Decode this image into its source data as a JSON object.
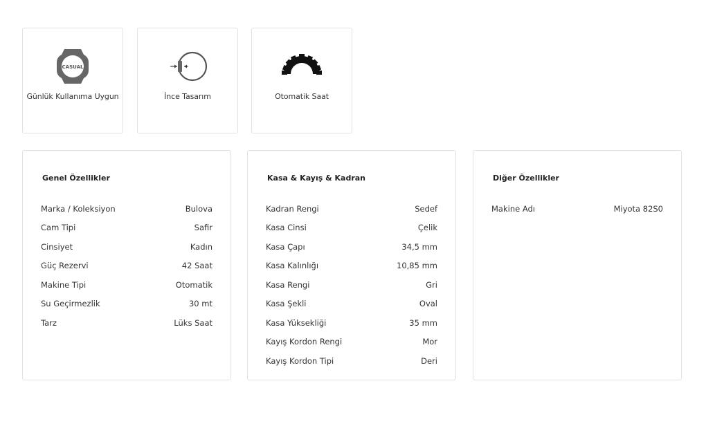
{
  "features": [
    {
      "icon": "casual-watch-icon",
      "badge_text": "CASUAL",
      "label": "Günlük Kullanıma Uygun"
    },
    {
      "icon": "thin-design-icon",
      "label": "İnce Tasarım"
    },
    {
      "icon": "automatic-gear-icon",
      "label": "Otomatik Saat"
    }
  ],
  "sections": [
    {
      "title": "Genel Özellikler",
      "rows": [
        {
          "key": "Marka / Koleksiyon",
          "value": "Bulova"
        },
        {
          "key": "Cam Tipi",
          "value": "Safir"
        },
        {
          "key": "Cinsiyet",
          "value": "Kadın"
        },
        {
          "key": "Güç Rezervi",
          "value": "42 Saat"
        },
        {
          "key": "Makine Tipi",
          "value": "Otomatik"
        },
        {
          "key": "Su Geçirmezlik",
          "value": "30 mt"
        },
        {
          "key": "Tarz",
          "value": "Lüks Saat"
        }
      ]
    },
    {
      "title": "Kasa & Kayış & Kadran",
      "rows": [
        {
          "key": "Kadran Rengi",
          "value": "Sedef"
        },
        {
          "key": "Kasa Cinsi",
          "value": "Çelik"
        },
        {
          "key": "Kasa Çapı",
          "value": "34,5 mm"
        },
        {
          "key": "Kasa Kalınlığı",
          "value": "10,85 mm"
        },
        {
          "key": "Kasa Rengi",
          "value": "Gri"
        },
        {
          "key": "Kasa Şekli",
          "value": "Oval"
        },
        {
          "key": "Kasa Yüksekliği",
          "value": "35 mm"
        },
        {
          "key": "Kayış Kordon Rengi",
          "value": "Mor"
        },
        {
          "key": "Kayış Kordon Tipi",
          "value": "Deri"
        }
      ]
    },
    {
      "title": "Diğer Özellikler",
      "rows": [
        {
          "key": "Makine Adı",
          "value": "Miyota 82S0"
        }
      ]
    }
  ]
}
